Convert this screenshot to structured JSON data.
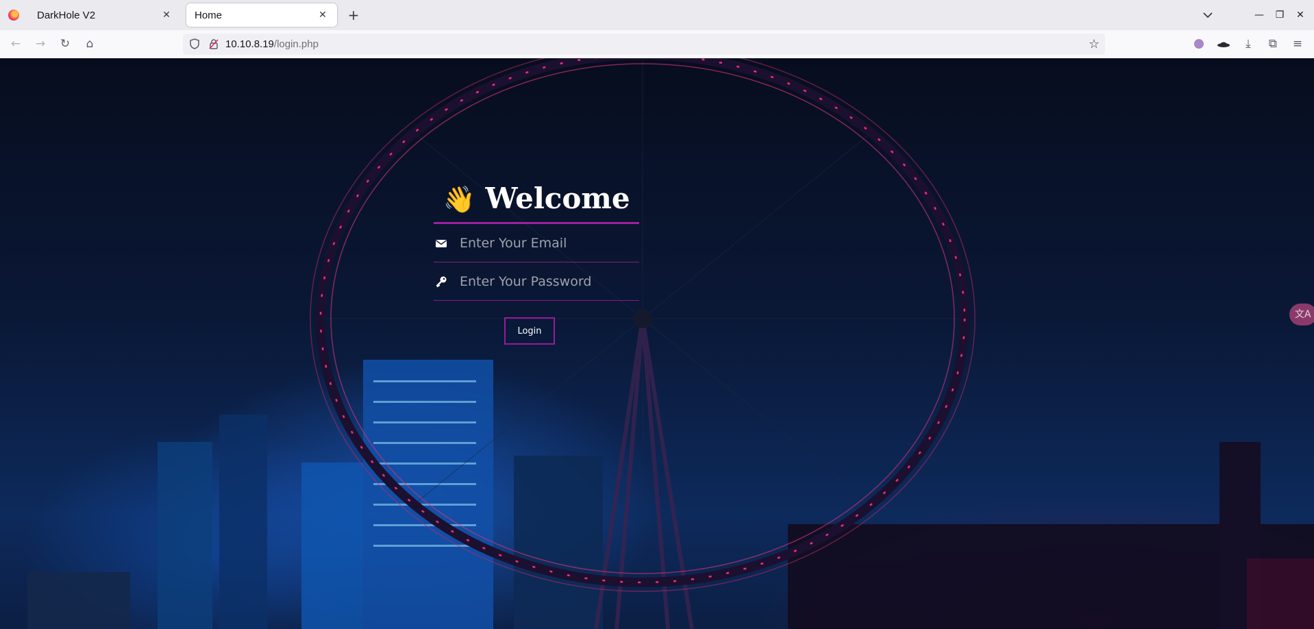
{
  "browser": {
    "tabs": [
      {
        "label": "DarkHole V2",
        "active": false
      },
      {
        "label": "Home",
        "active": true
      }
    ],
    "url": {
      "host": "10.10.8.19",
      "path": "/login.php"
    }
  },
  "login": {
    "title": "Welcome",
    "wave_emoji": "👋",
    "email_placeholder": "Enter Your Email",
    "password_placeholder": "Enter Your Password",
    "button_label": "Login"
  },
  "translate_badge": "文A",
  "icons": {
    "email": "envelope-icon",
    "password": "key-icon"
  },
  "colors": {
    "accent": "#9a1a9a",
    "ring": "#ff2f7a"
  }
}
